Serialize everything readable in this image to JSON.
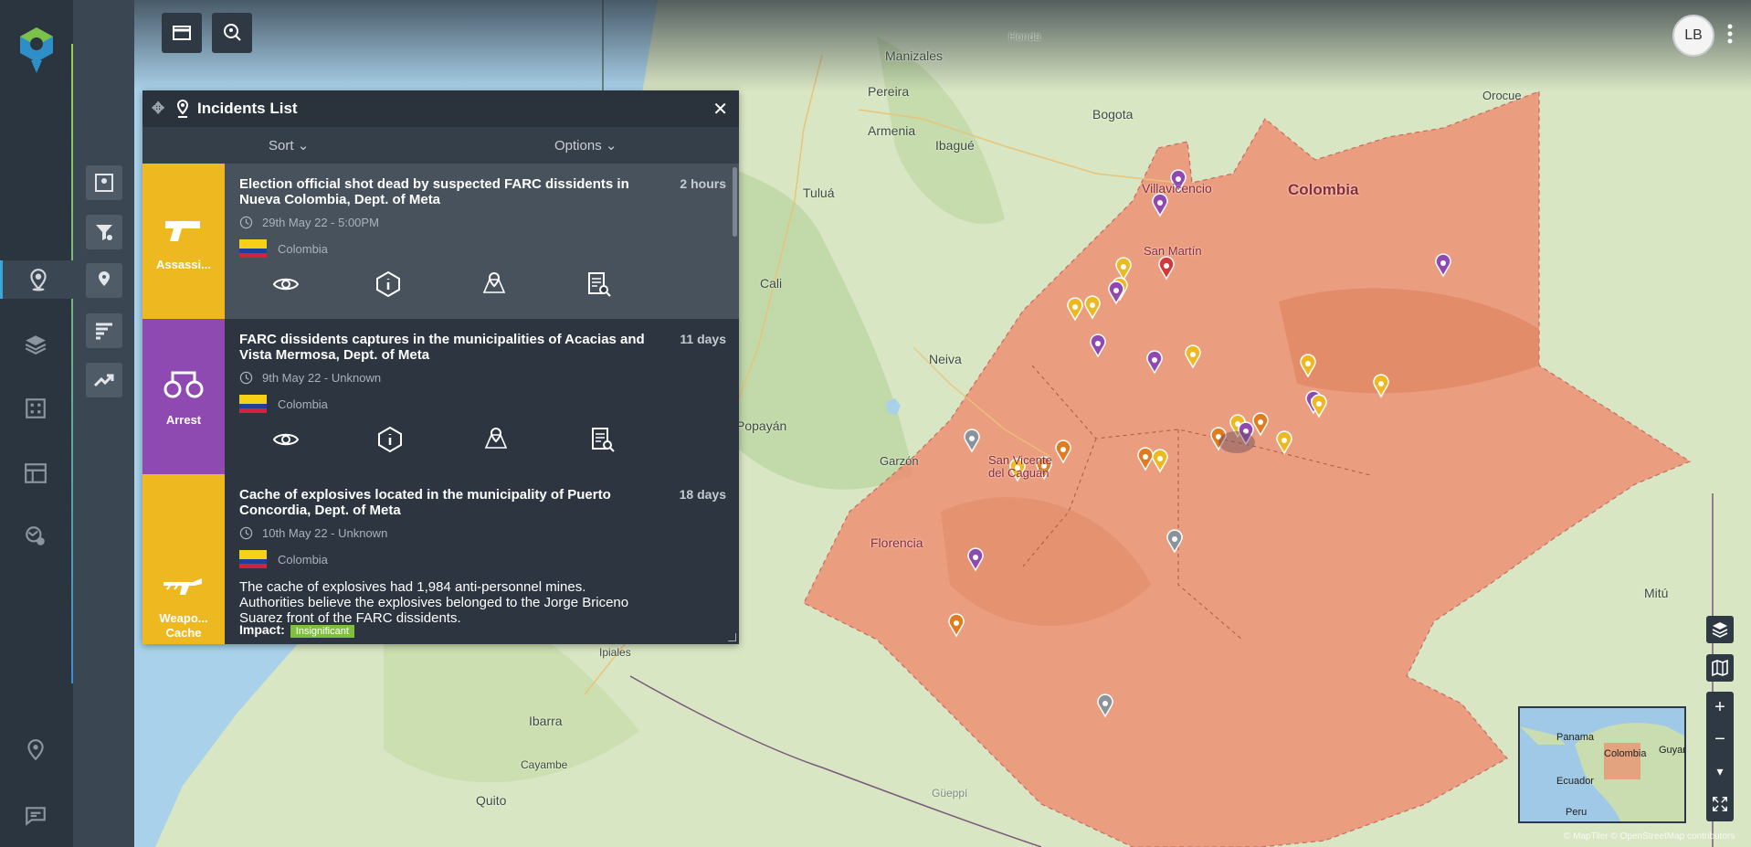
{
  "app": {
    "user_initials": "LB"
  },
  "colors": {
    "accent": "#3aa5d8",
    "assassination": "#eeb920",
    "arrest": "#8e4ab0",
    "weapons": "#eeb920",
    "region_fill": "#f08a6c"
  },
  "left_nav": {
    "items": [
      "incidents-icon",
      "layers-icon",
      "buildings-icon",
      "dashboard-icon",
      "risk-icon"
    ],
    "bottom": [
      "location-pin-icon",
      "feedback-icon"
    ]
  },
  "sub_nav": {
    "items": [
      "map-report-icon",
      "filter-settings-icon",
      "location-list-icon",
      "bar-sort-icon",
      "trend-icon"
    ]
  },
  "panel": {
    "title": "Incidents List",
    "sort_label": "Sort",
    "options_label": "Options",
    "incidents": [
      {
        "category": "Assassi...",
        "title": "Election official shot dead by suspected FARC dissidents in Nueva Colombia, Dept. of Meta",
        "ago": "2 hours",
        "date": "29th May 22 - 5:00PM",
        "country": "Colombia"
      },
      {
        "category": "Arrest",
        "title": "FARC dissidents captures in the municipalities of Acacias and Vista Mermosa, Dept. of Meta",
        "ago": "11 days",
        "date": "9th May 22 - Unknown",
        "country": "Colombia"
      },
      {
        "category": "Weapo... Cache",
        "title": "Cache of explosives located in the municipality of Puerto Concordia, Dept. of Meta",
        "ago": "18 days",
        "date": "10th May 22 - Unknown",
        "country": "Colombia",
        "description": "The cache of explosives had 1,984 anti-personnel mines. Authorities believe the explosives belonged to the Jorge Briceno Suarez front of the FARC dissidents.",
        "impact_label": "Impact:",
        "impact_value": "Insignificant"
      }
    ]
  },
  "map": {
    "labels": {
      "manizales": "Manizales",
      "honda": "Honda",
      "pereira": "Pereira",
      "bogota": "Bogota",
      "orocue": "Orocue",
      "armenia": "Armenia",
      "ibague": "Ibagué",
      "villavicencio": "Villavicencio",
      "colombia": "Colombia",
      "tulua": "Tuluá",
      "san_martin": "San Martín",
      "cali": "Cali",
      "neiva": "Neiva",
      "popayan": "Popayán",
      "garzon": "Garzón",
      "san_vicente": "San Vicente del Caguán",
      "florencia": "Florencia",
      "mitu": "Mitú",
      "ipiales": "Ipiales",
      "ibarra": "Ibarra",
      "cayambe": "Cayambe",
      "quito": "Quito",
      "guepi": "Güeppí"
    },
    "minimap": {
      "panama": "Panama",
      "colombia": "Colombia",
      "guyana": "Guyar",
      "ecuador": "Ecuador",
      "peru": "Peru"
    },
    "attribution": "© MapTiler © OpenStreetMap contributors",
    "zoom_in": "+",
    "zoom_out": "−",
    "compass": "▾"
  }
}
